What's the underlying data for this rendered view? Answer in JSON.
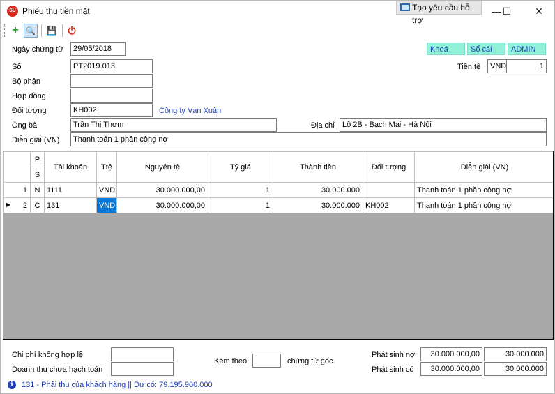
{
  "window": {
    "title": "Phiếu thu tiền mặt",
    "app_icon_text": "SU",
    "support_button": "Tạo yêu cầu hỗ trợ",
    "minimize": "—",
    "maximize": "☐",
    "close": "✕"
  },
  "toolbar": {
    "add_icon": "+",
    "search_icon": "🔍",
    "save_icon": "💾",
    "exit_icon": "⏻"
  },
  "form": {
    "date_label": "Ngày chứng từ",
    "date_value": "29/05/2018",
    "status_lock": "Khoá",
    "status_ledger": "Sổ cái",
    "status_user": "ADMIN",
    "number_label": "Số",
    "number_value": "PT2019.013",
    "currency_label": "Tiền tệ",
    "currency_code": "VND",
    "currency_rate": "1",
    "department_label": "Bộ phận",
    "department_value": "",
    "contract_label": "Hợp đồng",
    "contract_value": "",
    "object_label": "Đối tượng",
    "object_value": "KH002",
    "object_name": "Công ty Vạn Xuân",
    "person_label": "Ông bà",
    "person_value": "Trần Thị Thơm",
    "address_label": "Địa chỉ",
    "address_value": "Lô 2B - Bạch Mai - Hà Nội",
    "desc_label": "Diễn giải (VN)",
    "desc_value": "Thanh toán 1 phần công nợ"
  },
  "grid": {
    "headers": {
      "p": "P",
      "s": "S",
      "account": "Tài khoản",
      "currency": "Ttệ",
      "original": "Nguyên tệ",
      "rate": "Tỷ giá",
      "amount": "Thành tiền",
      "object": "Đối tượng",
      "desc": "Diễn giải (VN)"
    },
    "current_row_marker": "▶",
    "rows": [
      {
        "no": "1",
        "ps": "N",
        "account": "1111",
        "currency": "VND",
        "original": "30.000.000,00",
        "rate": "1",
        "amount": "30.000.000",
        "object": "",
        "desc": "Thanh toán 1 phần công nợ"
      },
      {
        "no": "2",
        "ps": "C",
        "account": "131",
        "currency": "VND",
        "original": "30.000.000,00",
        "rate": "1",
        "amount": "30.000.000",
        "object": "KH002",
        "desc": "Thanh toán 1 phần công nợ"
      }
    ]
  },
  "footer": {
    "invalid_cost_label": "Chi phí không hợp lệ",
    "invalid_cost_value": "",
    "unrecorded_revenue_label": "Doanh thu chưa hạch toán",
    "unrecorded_revenue_value": "",
    "attach_label": "Kèm theo",
    "attach_value": "",
    "attach_suffix": "chứng từ gốc.",
    "debit_label": "Phát sinh nợ",
    "debit_original": "30.000.000,00",
    "debit_amount": "30.000.000",
    "credit_label": "Phát sinh có",
    "credit_original": "30.000.000,00",
    "credit_amount": "30.000.000"
  },
  "statusbar": {
    "text": "131 - Phải thu của khách hàng || Dư có: 79.195.900.000"
  }
}
